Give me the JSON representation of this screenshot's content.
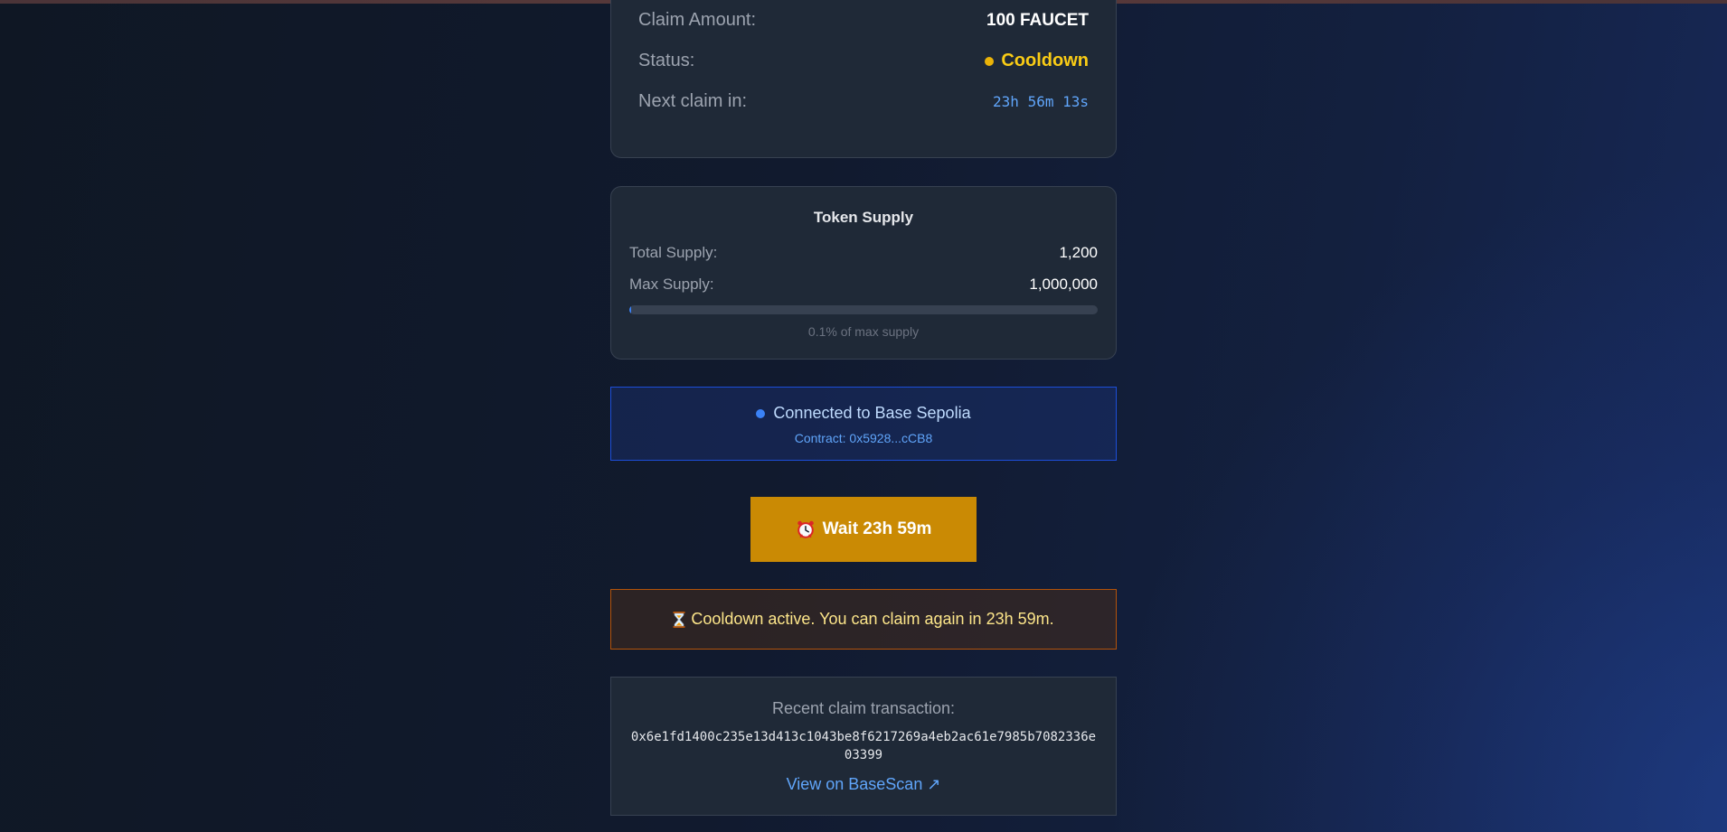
{
  "claim_info": {
    "amount_label": "Claim Amount:",
    "amount_value": "100 FAUCET",
    "status_label": "Status:",
    "status_value": "Cooldown",
    "status_color": "#eab308",
    "next_label": "Next claim in:",
    "next_value": "23h 56m 13s"
  },
  "token_supply": {
    "title": "Token Supply",
    "total_label": "Total Supply:",
    "total_value": "1,200",
    "max_label": "Max Supply:",
    "max_value": "1,000,000",
    "progress_percent": 0.12,
    "caption": "0.1% of max supply"
  },
  "network": {
    "status_text": "Connected to Base Sepolia",
    "contract_text": "Contract: 0x5928...cCB8",
    "dot_color": "#3b82f6"
  },
  "claim_button": {
    "icon": "alarm-clock-icon",
    "label": "Wait 23h 59m",
    "color": "#ca8a04"
  },
  "cooldown_alert": {
    "icon": "hourglass-icon",
    "message": "Cooldown active. You can claim again in 23h 59m."
  },
  "recent_tx": {
    "label": "Recent claim transaction:",
    "hash": "0x6e1fd1400c235e13d413c1043be8f6217269a4eb2ac61e7985b7082336e03399",
    "link_text": "View on BaseScan ↗"
  }
}
